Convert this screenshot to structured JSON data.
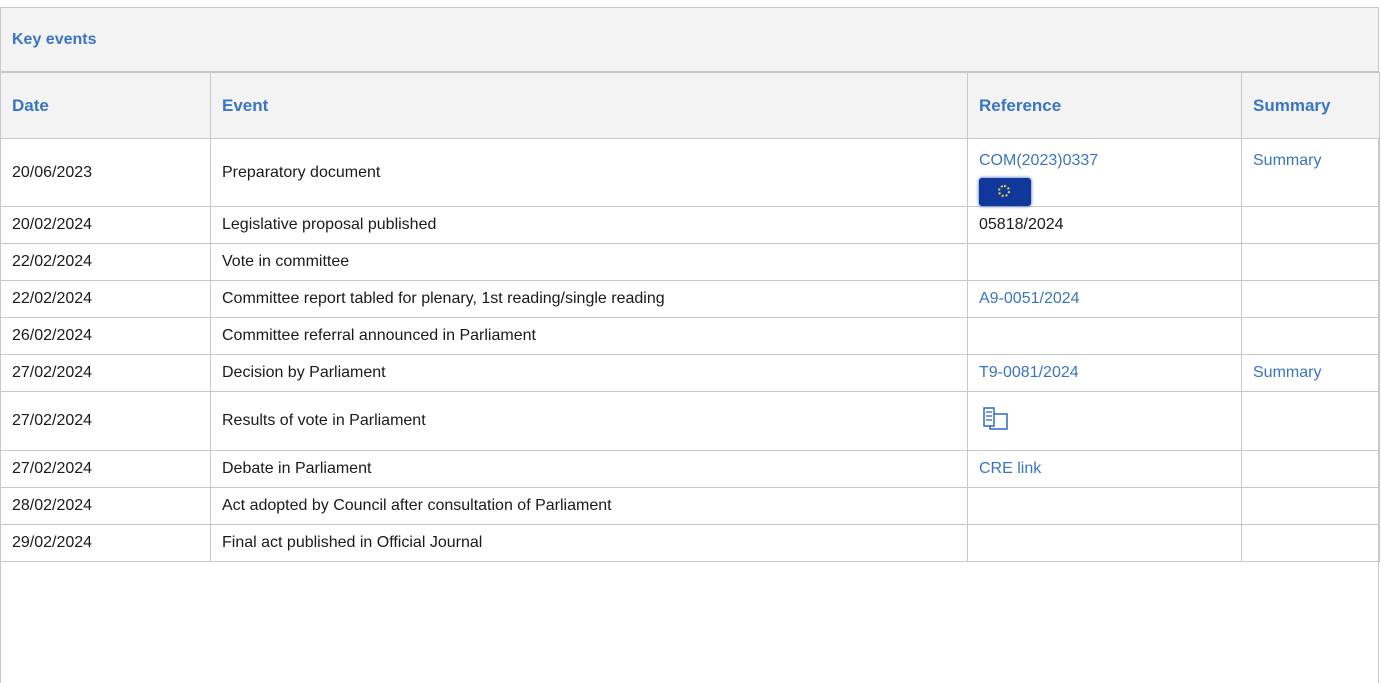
{
  "panel": {
    "title": "Key events"
  },
  "columns": {
    "date": "Date",
    "event": "Event",
    "reference": "Reference",
    "summary": "Summary"
  },
  "rows": [
    {
      "date": "20/06/2023",
      "event": "Preparatory document",
      "reference": "COM(2023)0337",
      "reference_icon": "eu-flag-icon",
      "summary": "Summary"
    },
    {
      "date": "20/02/2024",
      "event": "Legislative proposal published",
      "reference": "05818/2024",
      "summary": ""
    },
    {
      "date": "22/02/2024",
      "event": "Vote in committee",
      "reference": "",
      "summary": ""
    },
    {
      "date": "22/02/2024",
      "event": "Committee report tabled for plenary, 1st reading/single reading",
      "reference": "A9-0051/2024",
      "summary": ""
    },
    {
      "date": "26/02/2024",
      "event": "Committee referral announced in Parliament",
      "reference": "",
      "summary": ""
    },
    {
      "date": "27/02/2024",
      "event": "Decision by Parliament",
      "reference": "T9-0081/2024",
      "summary": "Summary"
    },
    {
      "date": "27/02/2024",
      "event": "Results of vote in Parliament",
      "reference": "",
      "reference_icon": "vote-results-icon",
      "summary": ""
    },
    {
      "date": "27/02/2024",
      "event": "Debate in Parliament",
      "reference": "CRE link",
      "summary": ""
    },
    {
      "date": "28/02/2024",
      "event": "Act adopted by Council after consultation of Parliament",
      "reference": "",
      "summary": ""
    },
    {
      "date": "29/02/2024",
      "event": "Final act published in Official Journal",
      "reference": "",
      "summary": ""
    }
  ],
  "colors": {
    "accent": "#3a75c4",
    "header_bg": "#f3f3f3",
    "border": "#c8c8c8"
  }
}
